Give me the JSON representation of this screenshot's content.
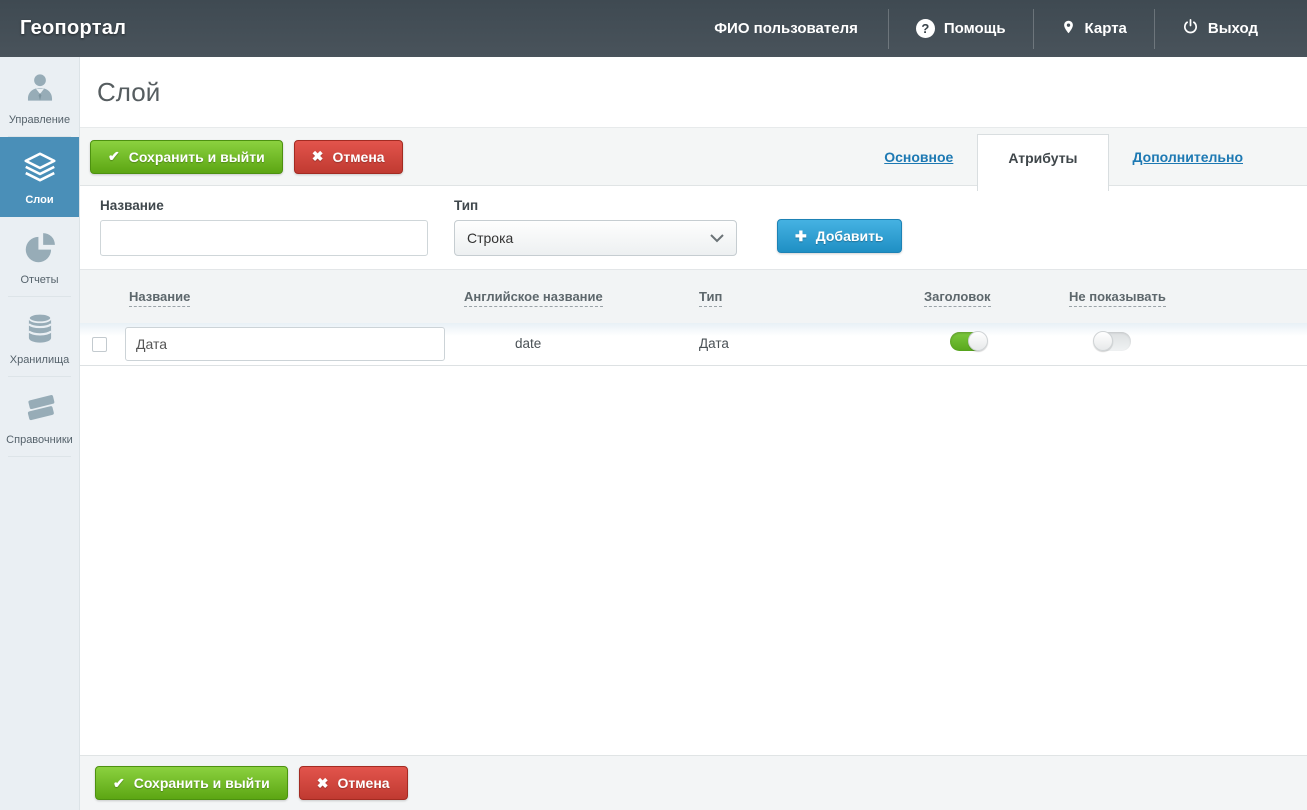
{
  "topbar": {
    "brand": "Геопортал",
    "user": "ФИО пользователя",
    "menu": [
      {
        "label": "Помощь",
        "icon": "help-icon"
      },
      {
        "label": "Карта",
        "icon": "map-pin-icon"
      },
      {
        "label": "Выход",
        "icon": "power-icon"
      }
    ]
  },
  "sidebar": {
    "items": [
      {
        "label": "Управление",
        "icon": "user-icon",
        "active": false
      },
      {
        "label": "Слои",
        "icon": "layers-icon",
        "active": true
      },
      {
        "label": "Отчеты",
        "icon": "pie-chart-icon",
        "active": false
      },
      {
        "label": "Хранилища",
        "icon": "database-icon",
        "active": false
      },
      {
        "label": "Справочники",
        "icon": "books-icon",
        "active": false
      }
    ]
  },
  "page": {
    "title": "Слой"
  },
  "actions": {
    "save": "Сохранить и выйти",
    "cancel": "Отмена"
  },
  "tabs": [
    {
      "label": "Основное",
      "active": false
    },
    {
      "label": "Атрибуты",
      "active": true
    },
    {
      "label": "Дополнительно",
      "active": false
    }
  ],
  "form": {
    "name_label": "Название",
    "name_value": "",
    "type_label": "Тип",
    "type_value": "Строка",
    "add_button": "Добавить"
  },
  "table": {
    "headers": [
      "Название",
      "Английское название",
      "Тип",
      "Заголовок",
      "Не показывать"
    ],
    "rows": [
      {
        "name": "Дата",
        "english_name": "date",
        "type": "Дата",
        "header_toggle": true,
        "hide_toggle": false,
        "checked": false
      }
    ]
  },
  "colors": {
    "topbar_bg": "#424d55",
    "sidebar_active": "#4a8fb8",
    "link_blue": "#1d79b3",
    "save_green": "#6cb52b",
    "cancel_red": "#d2413a",
    "add_blue": "#2f9fd3",
    "toggle_on_green": "#67b52c"
  }
}
